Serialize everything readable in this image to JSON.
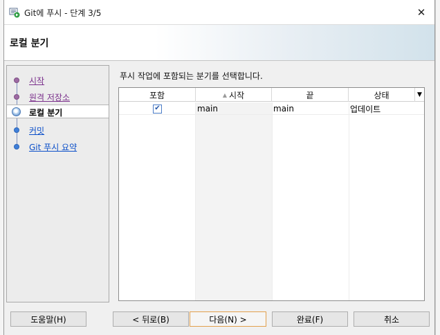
{
  "window": {
    "title": "Git에 푸시 - 단계 3/5",
    "close_glyph": "✕"
  },
  "banner": {
    "heading": "로컬 분기"
  },
  "steps": [
    {
      "label": "시작",
      "state": "visited"
    },
    {
      "label": "원격 저장소",
      "state": "visited"
    },
    {
      "label": "로컬 분기",
      "state": "current"
    },
    {
      "label": "커밋",
      "state": "future"
    },
    {
      "label": "Git 푸시 요약",
      "state": "future"
    }
  ],
  "content": {
    "instruction": "푸시 작업에 포함되는 분기를 선택합니다."
  },
  "table": {
    "columns": {
      "include": "포함",
      "start": "시작",
      "end": "끝",
      "status": "상태"
    },
    "sort_icon": "triangle-up-icon",
    "menu_glyph": "▼",
    "rows": [
      {
        "checked": true,
        "check_glyph": "✔",
        "start": "main",
        "end": "main",
        "status": "업데이트"
      }
    ]
  },
  "buttons": {
    "help": "도움말(H)",
    "back": "< 뒤로(B)",
    "next": "다음(N) >",
    "finish": "완료(F)",
    "cancel": "취소"
  },
  "colors": {
    "visited_link": "#7a2f8b",
    "future_link": "#0b4fc9",
    "default_button_border": "#e2a04d",
    "checkbox_border": "#4a7cc7"
  }
}
